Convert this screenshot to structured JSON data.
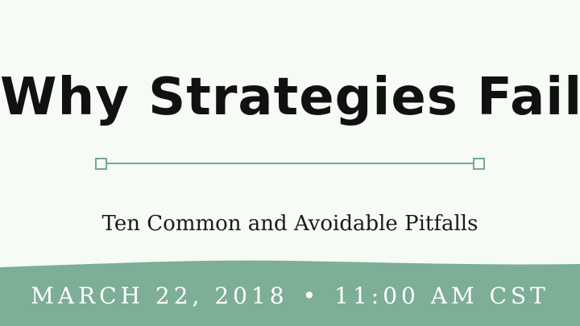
{
  "title": "Why Strategies Fail",
  "subtitle": "Ten Common and Avoidable Pitfalls",
  "event": {
    "date": "MARCH 22, 2018",
    "separator": "•",
    "time": "11:00 AM CST"
  },
  "colors": {
    "background": "#f6fbf5",
    "accent": "#74a892",
    "band": "#7dae96",
    "title_text": "#111111",
    "band_text": "#ffffff"
  }
}
